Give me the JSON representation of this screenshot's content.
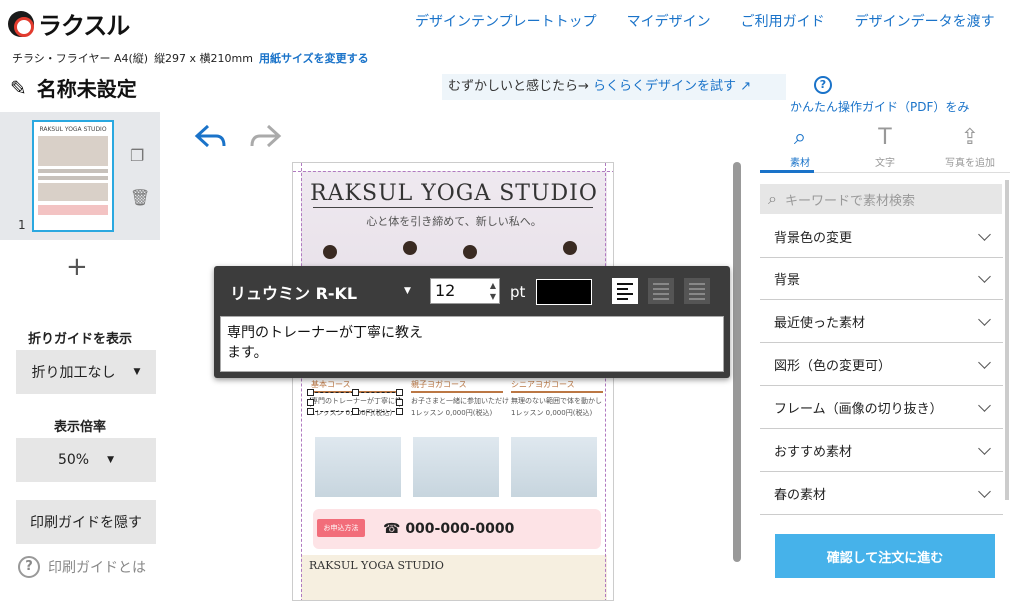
{
  "header": {
    "logo": "ラクスル",
    "nav": [
      "デザインテンプレートトップ",
      "マイデザイン",
      "ご利用ガイド",
      "デザインデータを渡す"
    ]
  },
  "size_info": {
    "product": "チラシ・フライヤー A4(縦)",
    "dims": "縦297 x 横210mm",
    "change_link": "用紙サイズを変更する"
  },
  "doc": {
    "title": "名称未設定"
  },
  "easy": {
    "prefix": "むずかしいと感じたら→ ",
    "link": "らくらくデザインを試す"
  },
  "help": {
    "label": "かんたん操作ガイド（PDF）をみ"
  },
  "pages": {
    "number": "1"
  },
  "left": {
    "fold_label": "折りガイドを表示",
    "fold_value": "折り加工なし",
    "zoom_label": "表示倍率",
    "zoom_value": "50%",
    "print_guide_button": "印刷ガイドを隠す",
    "print_guide_help": "印刷ガイドとは"
  },
  "canvas": {
    "title": "RAKSUL YOGA STUDIO",
    "subtitle": "心と体を引き締めて、新しい私へ。",
    "courses": [
      {
        "name": "基本コース",
        "line1": "専門のトレーナーが丁寧に教",
        "line2": "1レッスン 0,000円(税込)"
      },
      {
        "name": "親子ヨガコース",
        "line1": "お子さまと一緒に参加いただけ",
        "line2": "1レッスン 0,000円(税込)"
      },
      {
        "name": "シニアヨガコース",
        "line1": "無理のない範囲で体を動かし",
        "line2": "1レッスン 0,000円(税込)"
      }
    ],
    "apply_tag": "お申込方法",
    "phone": "☎ 000-000-0000",
    "footer": "RAKSUL YOGA STUDIO"
  },
  "font_popup": {
    "font": "リュウミン R-KL",
    "size": "12",
    "unit": "pt",
    "color": "#000000",
    "text": "専門のトレーナーが丁寧に教え\nます。"
  },
  "right": {
    "tabs": [
      "素材",
      "文字",
      "写真を追加"
    ],
    "search_placeholder": "キーワードで素材検索",
    "categories": [
      "背景色の変更",
      "背景",
      "最近使った素材",
      "図形（色の変更可）",
      "フレーム（画像の切り抜き）",
      "おすすめ素材",
      "春の素材"
    ],
    "order_button": "確認して注文に進む"
  },
  "colors": {
    "accent": "#1a73c9",
    "order": "#46b2ea",
    "selection": "#2aa8e0"
  }
}
